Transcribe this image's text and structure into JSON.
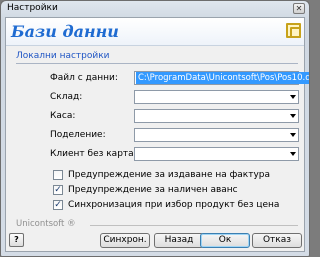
{
  "window": {
    "title": "Настройки",
    "close_glyph": "✕"
  },
  "header": {
    "title": "Бази данни",
    "logo_icon": "settings-logo-icon"
  },
  "section": {
    "caption": "Локални настройки"
  },
  "fields": [
    {
      "label": "Файл с данни:",
      "value": "C:\\ProgramData\\Unicontsoft\\Pos\\Pos10.db"
    },
    {
      "label": "Склад:",
      "value": ""
    },
    {
      "label": "Каса:",
      "value": ""
    },
    {
      "label": "Поделение:",
      "value": ""
    },
    {
      "label": "Клиент без карта:",
      "value": ""
    }
  ],
  "checkboxes": [
    {
      "label": "Предупреждение за издаване на фактура",
      "checked": false,
      "mark": ""
    },
    {
      "label": "Предупреждение за наличен аванс",
      "checked": true,
      "mark": "✓"
    },
    {
      "label": "Синхронизация при избор продукт без цена",
      "checked": true,
      "mark": "✓"
    }
  ],
  "footer": {
    "brand": "Unicontsoft ®"
  },
  "buttons": {
    "help": "?",
    "sync": "Синхрон.",
    "back": "Назад",
    "ok": "Ок",
    "cancel": "Отказ"
  },
  "colors": {
    "accent": "#1f6bd1",
    "selection": "#3399ff"
  }
}
